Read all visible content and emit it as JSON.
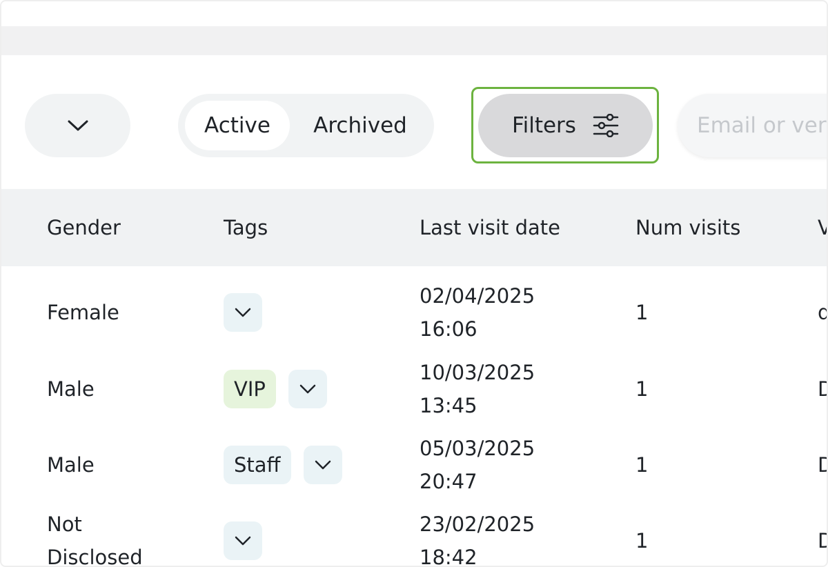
{
  "toolbar": {
    "status_tabs": [
      {
        "label": "Active",
        "selected": true
      },
      {
        "label": "Archived",
        "selected": false
      }
    ],
    "filters_label": "Filters",
    "search_placeholder": "Email or ver",
    "highlight_color": "#6cb33f"
  },
  "table": {
    "columns": [
      "Gender",
      "Tags",
      "Last visit date",
      "Num visits",
      "V"
    ],
    "rows": [
      {
        "gender": "Female",
        "tags": [],
        "date": "02/04/2025",
        "time": "16:06",
        "visits": "1",
        "next": "d"
      },
      {
        "gender": "Male",
        "tags": [
          {
            "label": "VIP",
            "color": "#e6f4dc"
          }
        ],
        "date": "10/03/2025",
        "time": "13:45",
        "visits": "1",
        "next": "D"
      },
      {
        "gender": "Male",
        "tags": [
          {
            "label": "Staff",
            "color": "#eaf3f6"
          }
        ],
        "date": "05/03/2025",
        "time": "20:47",
        "visits": "1",
        "next": "D"
      },
      {
        "gender_line1": "Not",
        "gender_line2": "Disclosed",
        "tags": [],
        "date": "23/02/2025",
        "time": "18:42",
        "visits": "1",
        "next": "D"
      }
    ]
  },
  "icons": {
    "dropdown": "chevron-down-icon",
    "filters": "sliders-icon",
    "tag_dropdown": "chevron-down-icon"
  }
}
